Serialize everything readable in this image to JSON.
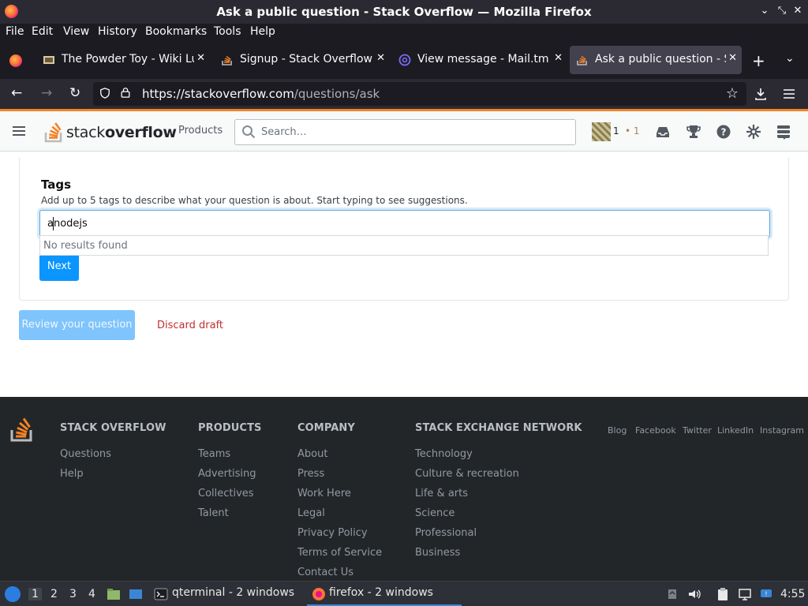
{
  "window": {
    "title": "Ask a public question - Stack Overflow — Mozilla Firefox"
  },
  "menubar": {
    "items": [
      "File",
      "Edit",
      "View",
      "History",
      "Bookmarks",
      "Tools",
      "Help"
    ]
  },
  "tabs": [
    {
      "label": "The Powder Toy - Wiki Lu",
      "active": false
    },
    {
      "label": "Signup - Stack Overflow",
      "active": false
    },
    {
      "label": "View message - Mail.tm",
      "active": false
    },
    {
      "label": "Ask a public question - St",
      "active": true
    }
  ],
  "navbar": {
    "url_host": "https://stackoverflow.com",
    "url_path": "/questions/ask"
  },
  "so_header": {
    "logo_word_plain": "stack",
    "logo_word_bold": "overflow",
    "products_label": "Products",
    "search_placeholder": "Search…",
    "reputation": "1",
    "bronze_badges": "• 1"
  },
  "tags_section": {
    "label": "Tags",
    "description": "Add up to 5 tags to describe what your question is about. Start typing to see suggestions.",
    "input_value": "anodejs",
    "dropdown_text": "No results found",
    "next_label": "Next"
  },
  "actions": {
    "review_label": "Review your question",
    "discard_label": "Discard draft"
  },
  "footer": {
    "columns": [
      {
        "heading": "STACK OVERFLOW",
        "links": [
          "Questions",
          "Help"
        ]
      },
      {
        "heading": "PRODUCTS",
        "links": [
          "Teams",
          "Advertising",
          "Collectives",
          "Talent"
        ]
      },
      {
        "heading": "COMPANY",
        "links": [
          "About",
          "Press",
          "Work Here",
          "Legal",
          "Privacy Policy",
          "Terms of Service",
          "Contact Us"
        ]
      },
      {
        "heading": "STACK EXCHANGE NETWORK",
        "links": [
          "Technology",
          "Culture & recreation",
          "Life & arts",
          "Science",
          "Professional",
          "Business"
        ]
      }
    ],
    "social": [
      "Blog",
      "Facebook",
      "Twitter",
      "LinkedIn",
      "Instagram"
    ]
  },
  "taskbar": {
    "workspaces": [
      "1",
      "2",
      "3",
      "4"
    ],
    "active_workspace": "1",
    "terminal_label": "qterminal - 2 windows",
    "firefox_label": "firefox - 2 windows",
    "clock": "4:55"
  },
  "colors": {
    "so_orange": "#f48225",
    "so_blue": "#0a95ff",
    "footer_bg": "#232629",
    "discard_red": "#c22e32"
  }
}
